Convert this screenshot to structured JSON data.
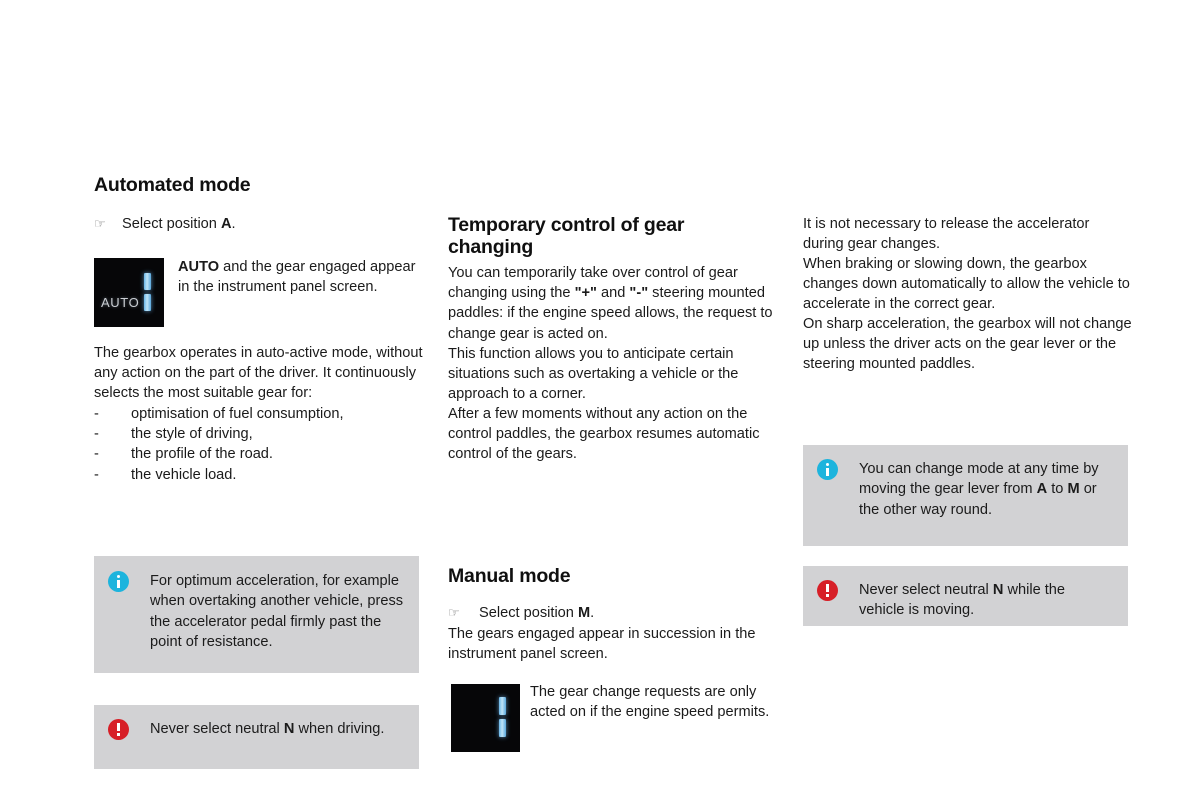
{
  "page": {
    "background_color": "#ffffff",
    "callout_background": "#d2d2d4",
    "info_icon_color": "#1db4dd",
    "warning_icon_color": "#d71f27",
    "display_background": "#060608",
    "display_segment_color": "#7cc0e8"
  },
  "left_column": {
    "heading": "Automated mode",
    "bullet_glyph": "☞",
    "bullet": {
      "prefix": "Select position ",
      "bold": "A",
      "suffix": "."
    },
    "display": {
      "label": "AUTO",
      "gear": "1"
    },
    "display_caption": {
      "bold": "AUTO",
      "text": " and the gear engaged appear in the instrument panel screen."
    },
    "paragraph": "The gearbox operates in auto-active mode, without any action on the part of the driver. It continuously selects the most suitable gear for:",
    "list_dash": "-",
    "list_items": [
      "optimisation of fuel consumption,",
      "the style of driving,",
      "the profile of the road.",
      "the vehicle load."
    ],
    "info_box": {
      "icon": "info-icon",
      "text": "For optimum acceleration, for example when overtaking another vehicle, press the accelerator pedal firmly past the point of resistance."
    },
    "warning_box": {
      "icon": "warning-icon",
      "prefix": "Never select neutral ",
      "bold": "N",
      "suffix": " when driving."
    }
  },
  "middle_column": {
    "heading": "Temporary control of gear changing",
    "paragraph_1_parts": {
      "a": "You can temporarily take over control of gear changing using the ",
      "b1": "\"+\"",
      "c": " and ",
      "b2": "\"-\"",
      "d": " steering mounted paddles: if the engine speed allows, the request to change gear is acted on."
    },
    "paragraph_2": "This function allows you to anticipate certain situations such as overtaking a vehicle or the approach to a corner.",
    "paragraph_3": "After a few moments without any action on the control paddles, the gearbox resumes automatic control of the gears.",
    "heading_2": "Manual mode",
    "bullet_glyph": "☞",
    "bullet": {
      "prefix": "Select position ",
      "bold": "M",
      "suffix": "."
    },
    "paragraph_4": "The gears engaged appear in succession in the instrument panel screen.",
    "display": {
      "gear": "1"
    },
    "display_caption": "The gear change requests are only acted on if the engine speed permits."
  },
  "right_column": {
    "paragraph_1": "It is not necessary to release the accelerator during gear changes.",
    "paragraph_2": "When braking or slowing down, the gearbox changes down automatically to allow the vehicle to accelerate in the correct gear.",
    "paragraph_3": "On sharp acceleration, the gearbox will not change up unless the driver acts on the gear lever or the steering mounted paddles.",
    "info_box": {
      "icon": "info-icon",
      "a": "You can change mode at any time by moving the gear lever from ",
      "b1": "A",
      "c": " to ",
      "b2": "M",
      "d": " or the other way round."
    },
    "warning_box": {
      "icon": "warning-icon",
      "prefix": "Never select neutral ",
      "bold": "N",
      "suffix": " while the vehicle is moving."
    }
  }
}
